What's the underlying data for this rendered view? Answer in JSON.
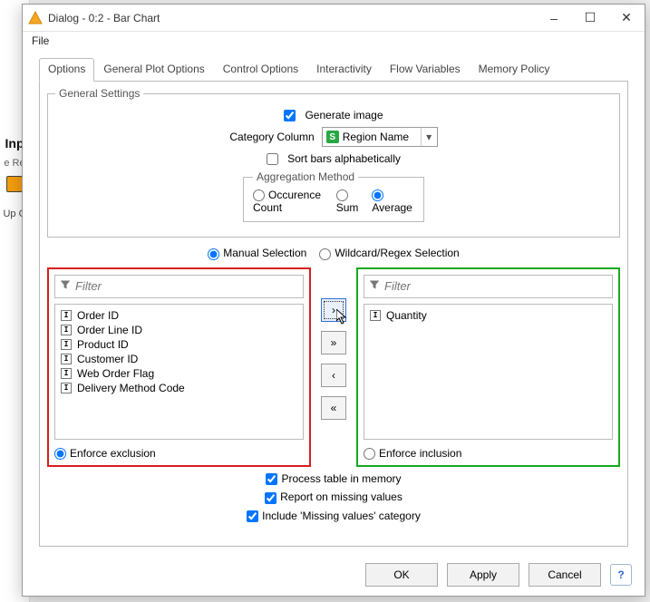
{
  "behind": {
    "snippet1": "Inp",
    "snippet2": "e Re",
    "snippet3": "Up C"
  },
  "window": {
    "title": "Dialog - 0:2 - Bar Chart",
    "menu": {
      "file": "File"
    },
    "tabs": [
      "Options",
      "General Plot Options",
      "Control Options",
      "Interactivity",
      "Flow Variables",
      "Memory Policy"
    ],
    "active_tab": 0
  },
  "general": {
    "legend": "General Settings",
    "generate_image": "Generate image",
    "category_label": "Category Column",
    "category_value": "Region Name",
    "sort_bars": "Sort bars alphabetically"
  },
  "aggregation": {
    "legend": "Aggregation Method",
    "occurrence": "Occurence Count",
    "sum": "Sum",
    "average": "Average"
  },
  "selection_mode": {
    "manual": "Manual Selection",
    "regex": "Wildcard/Regex Selection"
  },
  "filter_placeholder": "Filter",
  "exclude": {
    "items": [
      "Order ID",
      "Order Line ID",
      "Product ID",
      "Customer ID",
      "Web Order Flag",
      "Delivery Method Code"
    ],
    "enforce": "Enforce exclusion"
  },
  "include": {
    "items": [
      "Quantity"
    ],
    "enforce": "Enforce inclusion"
  },
  "mover": {
    "add": "›",
    "addall": "»",
    "remove": "‹",
    "removeall": "«"
  },
  "bottom": {
    "process_mem": "Process table in memory",
    "report_missing": "Report on missing values",
    "include_missing": "Include 'Missing values' category"
  },
  "footer": {
    "ok": "OK",
    "apply": "Apply",
    "cancel": "Cancel"
  }
}
